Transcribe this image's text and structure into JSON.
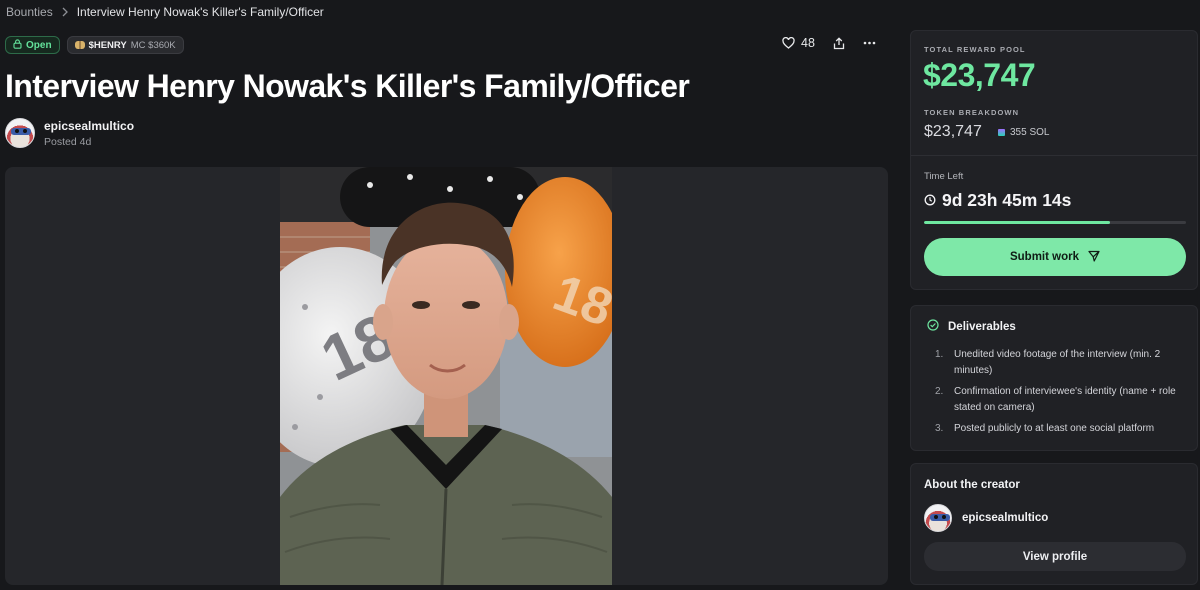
{
  "breadcrumb": {
    "root": "Bounties",
    "current": "Interview Henry Nowak's Killer's Family/Officer"
  },
  "tags": {
    "status": "Open",
    "token_symbol": "$HENRY",
    "market_cap": "MC $360K"
  },
  "actions": {
    "like_count": "48",
    "icons": [
      "heart-icon",
      "share-icon",
      "more-icon"
    ]
  },
  "bounty": {
    "title": "Interview Henry Nowak's Killer's Family/Officer",
    "creator": "epicsealmultico",
    "posted": "Posted 4d"
  },
  "reward": {
    "total_label": "TOTAL REWARD POOL",
    "total_amount": "$23,747",
    "breakdown_label": "TOKEN BREAKDOWN",
    "token_amount": "$23,747",
    "sol_amount": "355 SOL",
    "time_label": "Time Left",
    "time_value": "9d 23h 45m 14s",
    "time_progress": 0.71,
    "submit_label": "Submit work"
  },
  "deliverables": {
    "title": "Deliverables",
    "items": [
      {
        "num": "1.",
        "text": "Unedited video footage of the interview (min. 2 minutes)"
      },
      {
        "num": "2.",
        "text": "Confirmation of interviewee's identity (name + role stated on camera)"
      },
      {
        "num": "3.",
        "text": "Posted publicly to at least one social platform"
      }
    ]
  },
  "about": {
    "title": "About the creator",
    "creator": "epicsealmultico",
    "view_label": "View profile"
  },
  "colors": {
    "accent": "#6ee7a0",
    "button": "#7ee8a8",
    "background": "#17181b",
    "card": "#202125"
  }
}
